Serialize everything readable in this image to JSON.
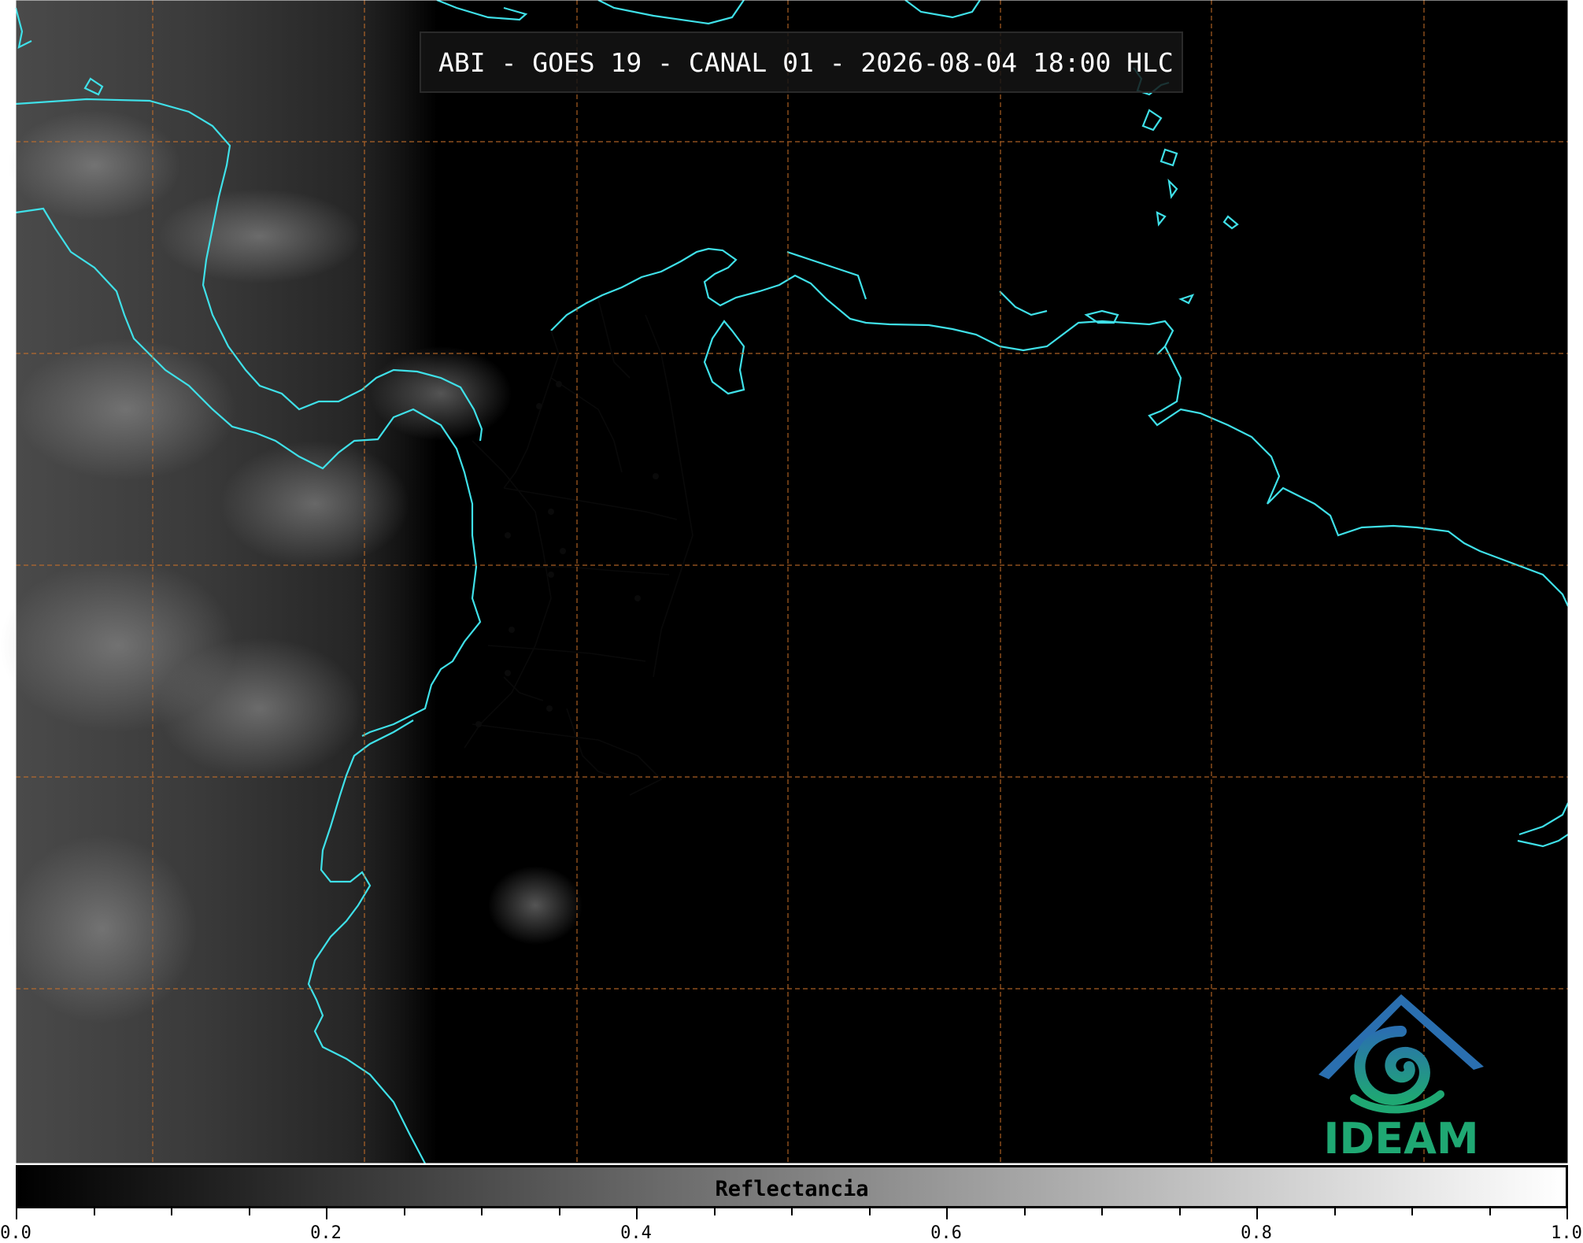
{
  "title": "ABI - GOES 19 - CANAL 01 - 2026-08-04 18:00 HLC",
  "colorbar": {
    "label": "Reflectancia",
    "ticks": [
      "0.0",
      "0.2",
      "0.4",
      "0.6",
      "0.8",
      "1.0"
    ],
    "min": 0.0,
    "max": 1.0,
    "gradient": [
      "#000000",
      "#ffffff"
    ]
  },
  "logo": {
    "text": "IDEAM",
    "colors": {
      "blue": "#2a6fb0",
      "teal": "#1b9e8e",
      "green": "#1fa873"
    }
  },
  "colors": {
    "coastline": "#3fe0e8",
    "grid": "#c8702a",
    "borders": "#0a0a0a",
    "background": "#000000"
  }
}
